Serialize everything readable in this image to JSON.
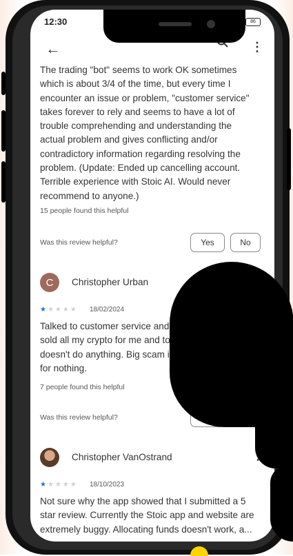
{
  "status_bar": {
    "time": "12:30",
    "battery": "86"
  },
  "top_bar": {
    "back_icon": "arrow-left-icon",
    "search_icon": "search-icon",
    "menu_icon": "more-vert-icon"
  },
  "reviews": [
    {
      "text_lines": [
        "The trading \"bot\" seems to work OK sometimes",
        "which is about 3/4 of the time, but every time I",
        "encounter an issue or problem, \"customer service\"",
        "takes forever to rely and seems to have a lot of",
        "trouble comprehending and understanding the",
        "actual problem and gives conflicting and/or",
        "contradictory information regarding resolving the",
        "problem. (Update: Ended up cancelling account.",
        "Terrible experience with Stoic AI. Would never",
        "recommend to anyone.)"
      ],
      "helpful_count": "15 people found this helpful",
      "was_helpful": "Was this review helpful?",
      "yes": "Yes",
      "no": "No"
    },
    {
      "author": "Christopher Urban",
      "avatar_letter": "C",
      "avatar_color": "#9e6a5c",
      "rating": 1,
      "date": "18/02/2024",
      "text_lines": [
        "Talked to customer service and",
        "sold all my crypto for me and to",
        "doesn't do anything. Big scam if y",
        "for nothing."
      ],
      "helpful_count": "7 people found this helpful",
      "was_helpful": "Was this review helpful?",
      "yes": "Yes",
      "no": "No"
    },
    {
      "author": "Christopher VanOstrand",
      "avatar_color": "#6b4a3a",
      "rating": 1,
      "date": "18/10/2023",
      "text_lines": [
        "Not sure why the app showed that I submitted a 5",
        "star review. Currently the Stoic app and website are",
        "extremely buggy. Allocating funds doesn't work, a..."
      ]
    }
  ]
}
